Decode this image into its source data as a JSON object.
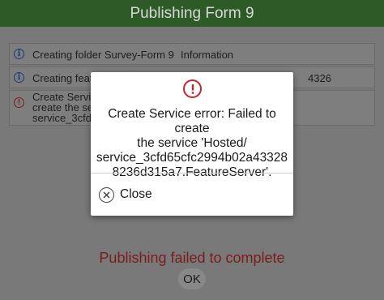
{
  "header": {
    "title": "Publishing Form 9"
  },
  "log": {
    "rows": [
      {
        "icon": "info-icon",
        "message": "Creating folder Survey-Form 9",
        "type": "Information",
        "tail": ""
      },
      {
        "icon": "info-icon",
        "message": "Creating featu",
        "type": "",
        "tail": "4326"
      },
      {
        "icon": "error-icon",
        "message": "Create Service\ncreate the servi\nservice_3cfd6",
        "type": "",
        "tail": ""
      }
    ]
  },
  "dialog": {
    "icon": "error-icon",
    "message": "Create Service error: Failed to create\nthe service 'Hosted/\nservice_3cfd65cfc2994b02a43328\n8236d315a7.FeatureServer'.",
    "close_label": "Close"
  },
  "footer": {
    "status": "Publishing failed to complete",
    "ok_label": "OK"
  },
  "colors": {
    "header_bg": "#2d5a26",
    "error_red": "#c3262b",
    "status_red": "#7a1c1c"
  }
}
